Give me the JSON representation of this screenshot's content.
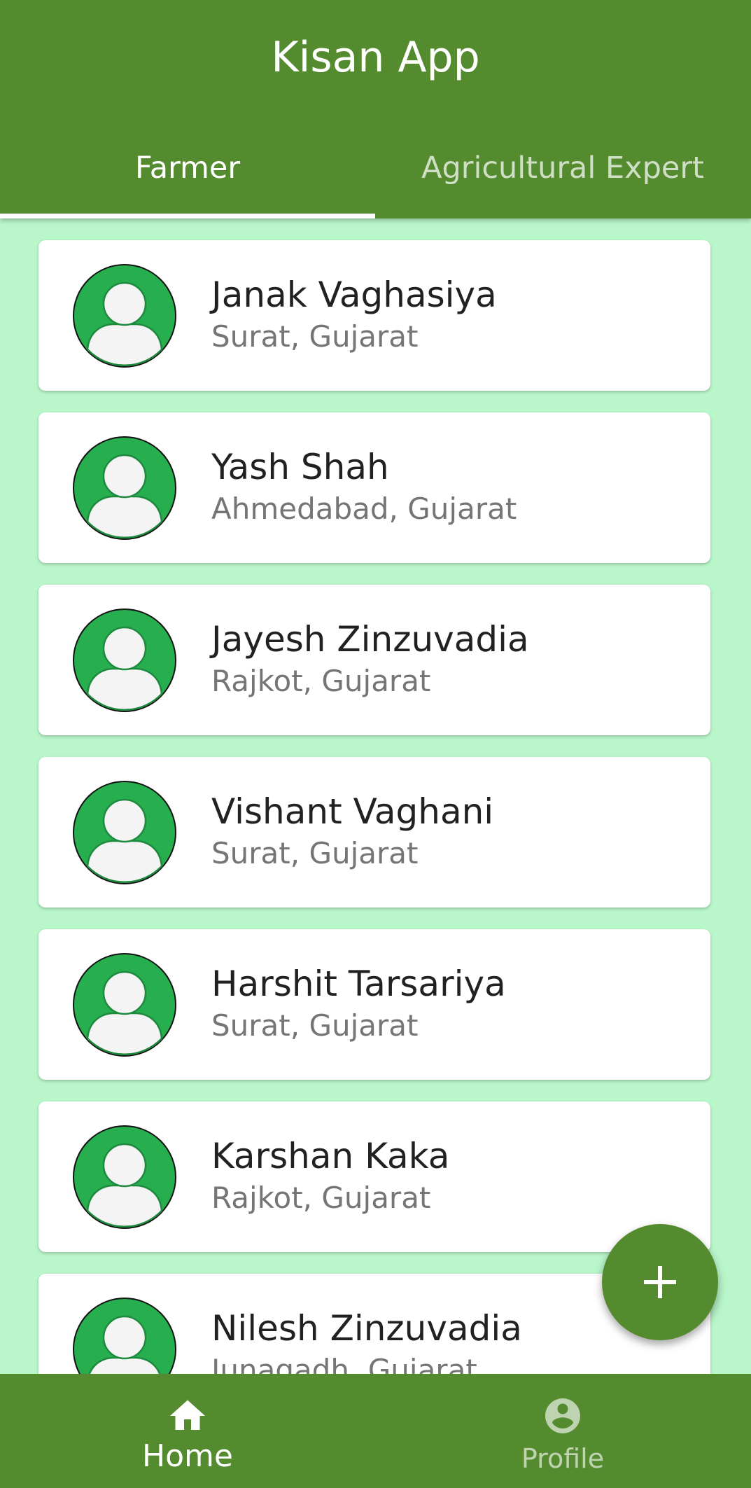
{
  "app": {
    "title": "Kisan App"
  },
  "tabs": [
    {
      "label": "Farmer",
      "selected": true
    },
    {
      "label": "Agricultural Expert",
      "selected": false
    }
  ],
  "people": [
    {
      "name": "Janak Vaghasiya",
      "location": "Surat, Gujarat"
    },
    {
      "name": "Yash Shah",
      "location": "Ahmedabad, Gujarat"
    },
    {
      "name": "Jayesh Zinzuvadia",
      "location": "Rajkot, Gujarat"
    },
    {
      "name": "Vishant Vaghani",
      "location": "Surat, Gujarat"
    },
    {
      "name": "Harshit Tarsariya",
      "location": "Surat, Gujarat"
    },
    {
      "name": "Karshan Kaka",
      "location": "Rajkot, Gujarat"
    },
    {
      "name": "Nilesh Zinzuvadia",
      "location": "Junagadh, Gujarat"
    }
  ],
  "fab": {
    "icon": "plus-icon"
  },
  "bottom_nav": [
    {
      "label": "Home",
      "icon": "home-icon",
      "selected": true
    },
    {
      "label": "Profile",
      "icon": "account-circle-icon",
      "selected": false
    }
  ],
  "colors": {
    "primary": "#558b2f",
    "background": "#b9f6ca",
    "avatar_green": "#27ae4f",
    "card": "#ffffff"
  }
}
